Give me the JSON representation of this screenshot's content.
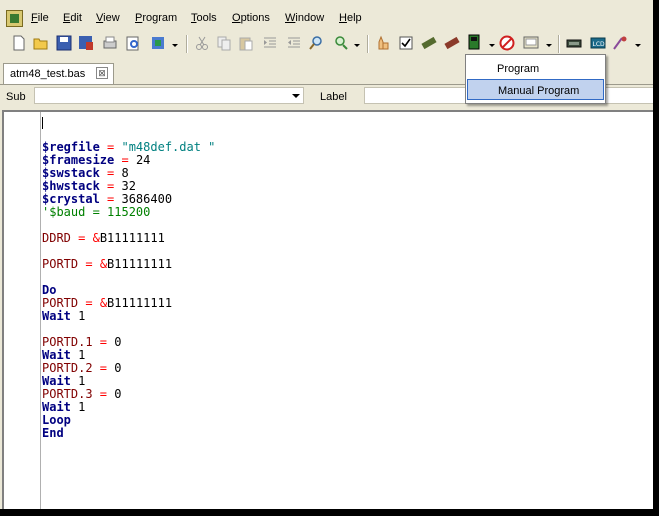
{
  "menu": [
    "File",
    "Edit",
    "View",
    "Program",
    "Tools",
    "Options",
    "Window",
    "Help"
  ],
  "menu_mnemonics": [
    "F",
    "E",
    "V",
    "P",
    "T",
    "O",
    "W",
    "H"
  ],
  "tab": {
    "title": "atm48_test.bas",
    "close": "⊠"
  },
  "subbar": {
    "sub_label": "Sub",
    "sub_value": "",
    "label_label": "Label",
    "label_value": ""
  },
  "dropdown": {
    "items": [
      "Program",
      "Manual Program"
    ],
    "highlighted": 1
  },
  "code": [
    {
      "parts": [
        [
          "$regfile",
          "kw"
        ],
        [
          " = ",
          "op"
        ],
        [
          "\"m48def.dat \"",
          "str"
        ]
      ]
    },
    {
      "parts": [
        [
          "$framesize",
          "kw"
        ],
        [
          " = ",
          "op"
        ],
        [
          "24",
          "num"
        ]
      ]
    },
    {
      "parts": [
        [
          "$swstack",
          "kw"
        ],
        [
          " = ",
          "op"
        ],
        [
          "8",
          "num"
        ]
      ]
    },
    {
      "parts": [
        [
          "$hwstack",
          "kw"
        ],
        [
          " = ",
          "op"
        ],
        [
          "32",
          "num"
        ]
      ]
    },
    {
      "parts": [
        [
          "$crystal",
          "kw"
        ],
        [
          " = ",
          "op"
        ],
        [
          "3686400",
          "num"
        ]
      ]
    },
    {
      "parts": [
        [
          "'$baud = 115200",
          "cmt"
        ]
      ]
    },
    {
      "parts": [
        [
          "DDRD",
          "var"
        ],
        [
          " = ",
          "op"
        ],
        [
          "&",
          "op"
        ],
        [
          "B11111111",
          "num"
        ]
      ]
    },
    {
      "parts": [
        [
          "PORTD",
          "var"
        ],
        [
          " = ",
          "op"
        ],
        [
          "&",
          "op"
        ],
        [
          "B11111111",
          "num"
        ]
      ]
    },
    {
      "parts": [
        [
          "Do",
          "kw"
        ]
      ]
    },
    {
      "parts": [
        [
          "PORTD",
          "var"
        ],
        [
          " = ",
          "op"
        ],
        [
          "&",
          "op"
        ],
        [
          "B11111111",
          "num"
        ]
      ]
    },
    {
      "parts": [
        [
          "Wait",
          "kw"
        ],
        [
          " 1",
          "num"
        ]
      ]
    },
    {
      "parts": [
        [
          "PORTD.1",
          "var"
        ],
        [
          " = ",
          "op"
        ],
        [
          "0",
          "num"
        ]
      ]
    },
    {
      "parts": [
        [
          "Wait",
          "kw"
        ],
        [
          " 1",
          "num"
        ]
      ]
    },
    {
      "parts": [
        [
          "PORTD.2",
          "var"
        ],
        [
          " = ",
          "op"
        ],
        [
          "0",
          "num"
        ]
      ]
    },
    {
      "parts": [
        [
          "Wait",
          "kw"
        ],
        [
          " 1",
          "num"
        ]
      ]
    },
    {
      "parts": [
        [
          "PORTD.3",
          "var"
        ],
        [
          " = ",
          "op"
        ],
        [
          "0",
          "num"
        ]
      ]
    },
    {
      "parts": [
        [
          "Wait",
          "kw"
        ],
        [
          " 1",
          "num"
        ]
      ]
    },
    {
      "parts": [
        [
          "Loop",
          "kw"
        ]
      ]
    },
    {
      "parts": [
        [
          "End",
          "kw"
        ]
      ]
    }
  ],
  "toolbar_icons": [
    "new-file-icon",
    "open-file-icon",
    "save-icon",
    "save-as-icon",
    "print-icon",
    "print-preview-icon",
    "properties-icon",
    "cut-icon",
    "copy-icon",
    "paste-icon",
    "indent-icon",
    "outdent-icon",
    "find-icon",
    "find-next-icon",
    "stop-icon",
    "check-icon",
    "compile-icon",
    "chip-icon",
    "program-icon",
    "stop-red-icon",
    "terminal-icon",
    "lcd-designer-icon",
    "lcd-icon",
    "options-icon"
  ],
  "colors": {
    "keyword": "#000080",
    "variable": "#800000",
    "operator": "#ff0000",
    "string": "#008080",
    "comment": "#008000",
    "highlight": "#c1d2ee"
  }
}
